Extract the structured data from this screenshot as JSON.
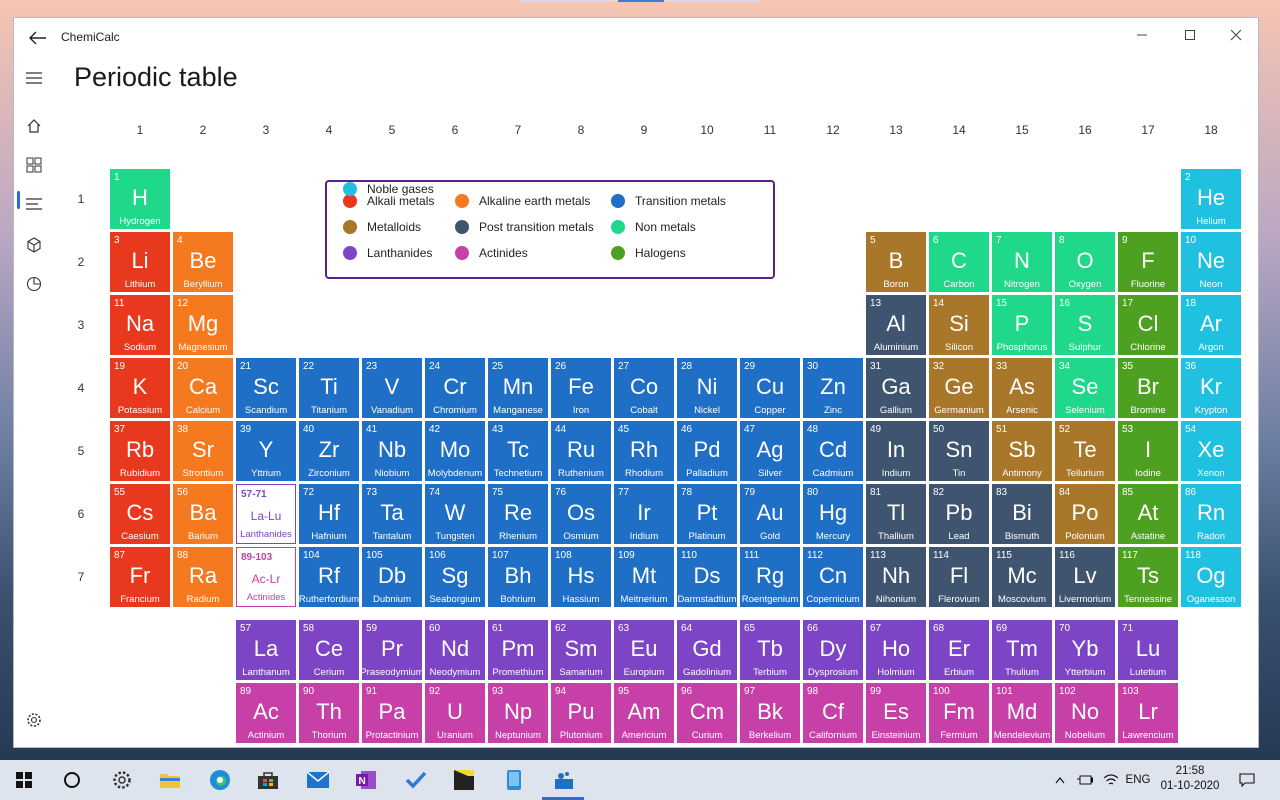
{
  "window": {
    "title": "ChemiCalc"
  },
  "page": {
    "title": "Periodic table"
  },
  "columns": [
    "1",
    "2",
    "3",
    "4",
    "5",
    "6",
    "7",
    "8",
    "9",
    "10",
    "11",
    "12",
    "13",
    "14",
    "15",
    "16",
    "17",
    "18"
  ],
  "periods": [
    "1",
    "2",
    "3",
    "4",
    "5",
    "6",
    "7"
  ],
  "colors": {
    "alkali": "#e8381e",
    "alkaline": "#f4791f",
    "transition": "#1f6fc6",
    "metalloid": "#a8772a",
    "post": "#3e546f",
    "nonmetal": "#20d88a",
    "lanthanide": "#7d45c6",
    "actinide": "#c640a8",
    "halogen": "#4ea120",
    "noble": "#1fc0e0"
  },
  "legend": [
    {
      "label": "Alkali metals",
      "cat": "alkali"
    },
    {
      "label": "Alkaline earth metals",
      "cat": "alkaline"
    },
    {
      "label": "Transition metals",
      "cat": "transition"
    },
    {
      "label": "Metalloids",
      "cat": "metalloid"
    },
    {
      "label": "Post transition metals",
      "cat": "post"
    },
    {
      "label": "Non metals",
      "cat": "nonmetal"
    },
    {
      "label": "Lanthanides",
      "cat": "lanthanide"
    },
    {
      "label": "Actinides",
      "cat": "actinide"
    },
    {
      "label": "Halogens",
      "cat": "halogen"
    },
    {
      "label": "Noble gases",
      "cat": "noble"
    }
  ],
  "placeholders": [
    {
      "range": "57-71",
      "symbol": "La-Lu",
      "name": "Lanthanides",
      "group": 3,
      "period": 6,
      "cat": "lanthanide"
    },
    {
      "range": "89-103",
      "symbol": "Ac-Lr",
      "name": "Actinides",
      "group": 3,
      "period": 7,
      "cat": "actinide"
    }
  ],
  "elements": [
    {
      "n": 1,
      "s": "H",
      "name": "Hydrogen",
      "g": 1,
      "p": 1,
      "c": "nonmetal"
    },
    {
      "n": 2,
      "s": "He",
      "name": "Helium",
      "g": 18,
      "p": 1,
      "c": "noble"
    },
    {
      "n": 3,
      "s": "Li",
      "name": "Lithium",
      "g": 1,
      "p": 2,
      "c": "alkali"
    },
    {
      "n": 4,
      "s": "Be",
      "name": "Beryllium",
      "g": 2,
      "p": 2,
      "c": "alkaline"
    },
    {
      "n": 5,
      "s": "B",
      "name": "Boron",
      "g": 13,
      "p": 2,
      "c": "metalloid"
    },
    {
      "n": 6,
      "s": "C",
      "name": "Carbon",
      "g": 14,
      "p": 2,
      "c": "nonmetal"
    },
    {
      "n": 7,
      "s": "N",
      "name": "Nitrogen",
      "g": 15,
      "p": 2,
      "c": "nonmetal"
    },
    {
      "n": 8,
      "s": "O",
      "name": "Oxygen",
      "g": 16,
      "p": 2,
      "c": "nonmetal"
    },
    {
      "n": 9,
      "s": "F",
      "name": "Fluorine",
      "g": 17,
      "p": 2,
      "c": "halogen"
    },
    {
      "n": 10,
      "s": "Ne",
      "name": "Neon",
      "g": 18,
      "p": 2,
      "c": "noble"
    },
    {
      "n": 11,
      "s": "Na",
      "name": "Sodium",
      "g": 1,
      "p": 3,
      "c": "alkali"
    },
    {
      "n": 12,
      "s": "Mg",
      "name": "Magnesium",
      "g": 2,
      "p": 3,
      "c": "alkaline"
    },
    {
      "n": 13,
      "s": "Al",
      "name": "Aluminium",
      "g": 13,
      "p": 3,
      "c": "post"
    },
    {
      "n": 14,
      "s": "Si",
      "name": "Silicon",
      "g": 14,
      "p": 3,
      "c": "metalloid"
    },
    {
      "n": 15,
      "s": "P",
      "name": "Phosphorus",
      "g": 15,
      "p": 3,
      "c": "nonmetal"
    },
    {
      "n": 16,
      "s": "S",
      "name": "Sulphur",
      "g": 16,
      "p": 3,
      "c": "nonmetal"
    },
    {
      "n": 17,
      "s": "Cl",
      "name": "Chlorine",
      "g": 17,
      "p": 3,
      "c": "halogen"
    },
    {
      "n": 18,
      "s": "Ar",
      "name": "Argon",
      "g": 18,
      "p": 3,
      "c": "noble"
    },
    {
      "n": 19,
      "s": "K",
      "name": "Potassium",
      "g": 1,
      "p": 4,
      "c": "alkali"
    },
    {
      "n": 20,
      "s": "Ca",
      "name": "Calcium",
      "g": 2,
      "p": 4,
      "c": "alkaline"
    },
    {
      "n": 21,
      "s": "Sc",
      "name": "Scandium",
      "g": 3,
      "p": 4,
      "c": "transition"
    },
    {
      "n": 22,
      "s": "Ti",
      "name": "Titanium",
      "g": 4,
      "p": 4,
      "c": "transition"
    },
    {
      "n": 23,
      "s": "V",
      "name": "Vanadium",
      "g": 5,
      "p": 4,
      "c": "transition"
    },
    {
      "n": 24,
      "s": "Cr",
      "name": "Chromium",
      "g": 6,
      "p": 4,
      "c": "transition"
    },
    {
      "n": 25,
      "s": "Mn",
      "name": "Manganese",
      "g": 7,
      "p": 4,
      "c": "transition"
    },
    {
      "n": 26,
      "s": "Fe",
      "name": "Iron",
      "g": 8,
      "p": 4,
      "c": "transition"
    },
    {
      "n": 27,
      "s": "Co",
      "name": "Cobalt",
      "g": 9,
      "p": 4,
      "c": "transition"
    },
    {
      "n": 28,
      "s": "Ni",
      "name": "Nickel",
      "g": 10,
      "p": 4,
      "c": "transition"
    },
    {
      "n": 29,
      "s": "Cu",
      "name": "Copper",
      "g": 11,
      "p": 4,
      "c": "transition"
    },
    {
      "n": 30,
      "s": "Zn",
      "name": "Zinc",
      "g": 12,
      "p": 4,
      "c": "transition"
    },
    {
      "n": 31,
      "s": "Ga",
      "name": "Gallium",
      "g": 13,
      "p": 4,
      "c": "post"
    },
    {
      "n": 32,
      "s": "Ge",
      "name": "Germanium",
      "g": 14,
      "p": 4,
      "c": "metalloid"
    },
    {
      "n": 33,
      "s": "As",
      "name": "Arsenic",
      "g": 15,
      "p": 4,
      "c": "metalloid"
    },
    {
      "n": 34,
      "s": "Se",
      "name": "Selenium",
      "g": 16,
      "p": 4,
      "c": "nonmetal"
    },
    {
      "n": 35,
      "s": "Br",
      "name": "Bromine",
      "g": 17,
      "p": 4,
      "c": "halogen"
    },
    {
      "n": 36,
      "s": "Kr",
      "name": "Krypton",
      "g": 18,
      "p": 4,
      "c": "noble"
    },
    {
      "n": 37,
      "s": "Rb",
      "name": "Rubidium",
      "g": 1,
      "p": 5,
      "c": "alkali"
    },
    {
      "n": 38,
      "s": "Sr",
      "name": "Strontium",
      "g": 2,
      "p": 5,
      "c": "alkaline"
    },
    {
      "n": 39,
      "s": "Y",
      "name": "Yttrium",
      "g": 3,
      "p": 5,
      "c": "transition"
    },
    {
      "n": 40,
      "s": "Zr",
      "name": "Zirconium",
      "g": 4,
      "p": 5,
      "c": "transition"
    },
    {
      "n": 41,
      "s": "Nb",
      "name": "Niobium",
      "g": 5,
      "p": 5,
      "c": "transition"
    },
    {
      "n": 42,
      "s": "Mo",
      "name": "Molybdenum",
      "g": 6,
      "p": 5,
      "c": "transition"
    },
    {
      "n": 43,
      "s": "Tc",
      "name": "Technetium",
      "g": 7,
      "p": 5,
      "c": "transition"
    },
    {
      "n": 44,
      "s": "Ru",
      "name": "Ruthenium",
      "g": 8,
      "p": 5,
      "c": "transition"
    },
    {
      "n": 45,
      "s": "Rh",
      "name": "Rhodium",
      "g": 9,
      "p": 5,
      "c": "transition"
    },
    {
      "n": 46,
      "s": "Pd",
      "name": "Palladium",
      "g": 10,
      "p": 5,
      "c": "transition"
    },
    {
      "n": 47,
      "s": "Ag",
      "name": "Silver",
      "g": 11,
      "p": 5,
      "c": "transition"
    },
    {
      "n": 48,
      "s": "Cd",
      "name": "Cadmium",
      "g": 12,
      "p": 5,
      "c": "transition"
    },
    {
      "n": 49,
      "s": "In",
      "name": "Indium",
      "g": 13,
      "p": 5,
      "c": "post"
    },
    {
      "n": 50,
      "s": "Sn",
      "name": "Tin",
      "g": 14,
      "p": 5,
      "c": "post"
    },
    {
      "n": 51,
      "s": "Sb",
      "name": "Antimony",
      "g": 15,
      "p": 5,
      "c": "metalloid"
    },
    {
      "n": 52,
      "s": "Te",
      "name": "Tellurium",
      "g": 16,
      "p": 5,
      "c": "metalloid"
    },
    {
      "n": 53,
      "s": "I",
      "name": "Iodine",
      "g": 17,
      "p": 5,
      "c": "halogen"
    },
    {
      "n": 54,
      "s": "Xe",
      "name": "Xenon",
      "g": 18,
      "p": 5,
      "c": "noble"
    },
    {
      "n": 55,
      "s": "Cs",
      "name": "Caesium",
      "g": 1,
      "p": 6,
      "c": "alkali"
    },
    {
      "n": 56,
      "s": "Ba",
      "name": "Barium",
      "g": 2,
      "p": 6,
      "c": "alkaline"
    },
    {
      "n": 72,
      "s": "Hf",
      "name": "Hafnium",
      "g": 4,
      "p": 6,
      "c": "transition"
    },
    {
      "n": 73,
      "s": "Ta",
      "name": "Tantalum",
      "g": 5,
      "p": 6,
      "c": "transition"
    },
    {
      "n": 74,
      "s": "W",
      "name": "Tungsten",
      "g": 6,
      "p": 6,
      "c": "transition"
    },
    {
      "n": 75,
      "s": "Re",
      "name": "Rhenium",
      "g": 7,
      "p": 6,
      "c": "transition"
    },
    {
      "n": 76,
      "s": "Os",
      "name": "Osmium",
      "g": 8,
      "p": 6,
      "c": "transition"
    },
    {
      "n": 77,
      "s": "Ir",
      "name": "Iridium",
      "g": 9,
      "p": 6,
      "c": "transition"
    },
    {
      "n": 78,
      "s": "Pt",
      "name": "Platinum",
      "g": 10,
      "p": 6,
      "c": "transition"
    },
    {
      "n": 79,
      "s": "Au",
      "name": "Gold",
      "g": 11,
      "p": 6,
      "c": "transition"
    },
    {
      "n": 80,
      "s": "Hg",
      "name": "Mercury",
      "g": 12,
      "p": 6,
      "c": "transition"
    },
    {
      "n": 81,
      "s": "Tl",
      "name": "Thallium",
      "g": 13,
      "p": 6,
      "c": "post"
    },
    {
      "n": 82,
      "s": "Pb",
      "name": "Lead",
      "g": 14,
      "p": 6,
      "c": "post"
    },
    {
      "n": 83,
      "s": "Bi",
      "name": "Bismuth",
      "g": 15,
      "p": 6,
      "c": "post"
    },
    {
      "n": 84,
      "s": "Po",
      "name": "Polonium",
      "g": 16,
      "p": 6,
      "c": "metalloid"
    },
    {
      "n": 85,
      "s": "At",
      "name": "Astatine",
      "g": 17,
      "p": 6,
      "c": "halogen"
    },
    {
      "n": 86,
      "s": "Rn",
      "name": "Radon",
      "g": 18,
      "p": 6,
      "c": "noble"
    },
    {
      "n": 87,
      "s": "Fr",
      "name": "Francium",
      "g": 1,
      "p": 7,
      "c": "alkali"
    },
    {
      "n": 88,
      "s": "Ra",
      "name": "Radium",
      "g": 2,
      "p": 7,
      "c": "alkaline"
    },
    {
      "n": 104,
      "s": "Rf",
      "name": "Rutherfordium",
      "g": 4,
      "p": 7,
      "c": "transition"
    },
    {
      "n": 105,
      "s": "Db",
      "name": "Dubnium",
      "g": 5,
      "p": 7,
      "c": "transition"
    },
    {
      "n": 106,
      "s": "Sg",
      "name": "Seaborgium",
      "g": 6,
      "p": 7,
      "c": "transition"
    },
    {
      "n": 107,
      "s": "Bh",
      "name": "Bohrium",
      "g": 7,
      "p": 7,
      "c": "transition"
    },
    {
      "n": 108,
      "s": "Hs",
      "name": "Hassium",
      "g": 8,
      "p": 7,
      "c": "transition"
    },
    {
      "n": 109,
      "s": "Mt",
      "name": "Meitnerium",
      "g": 9,
      "p": 7,
      "c": "transition"
    },
    {
      "n": 110,
      "s": "Ds",
      "name": "Darmstadtium",
      "g": 10,
      "p": 7,
      "c": "transition"
    },
    {
      "n": 111,
      "s": "Rg",
      "name": "Roentgenium",
      "g": 11,
      "p": 7,
      "c": "transition"
    },
    {
      "n": 112,
      "s": "Cn",
      "name": "Copernicium",
      "g": 12,
      "p": 7,
      "c": "transition"
    },
    {
      "n": 113,
      "s": "Nh",
      "name": "Nihonium",
      "g": 13,
      "p": 7,
      "c": "post"
    },
    {
      "n": 114,
      "s": "Fl",
      "name": "Flerovium",
      "g": 14,
      "p": 7,
      "c": "post"
    },
    {
      "n": 115,
      "s": "Mc",
      "name": "Moscovium",
      "g": 15,
      "p": 7,
      "c": "post"
    },
    {
      "n": 116,
      "s": "Lv",
      "name": "Livermorium",
      "g": 16,
      "p": 7,
      "c": "post"
    },
    {
      "n": 117,
      "s": "Ts",
      "name": "Tennessine",
      "g": 17,
      "p": 7,
      "c": "halogen"
    },
    {
      "n": 118,
      "s": "Og",
      "name": "Oganesson",
      "g": 18,
      "p": 7,
      "c": "noble"
    }
  ],
  "lanthanides": [
    {
      "n": 57,
      "s": "La",
      "name": "Lanthanum"
    },
    {
      "n": 58,
      "s": "Ce",
      "name": "Cerium"
    },
    {
      "n": 59,
      "s": "Pr",
      "name": "Praseodymium"
    },
    {
      "n": 60,
      "s": "Nd",
      "name": "Neodymium"
    },
    {
      "n": 61,
      "s": "Pm",
      "name": "Promethium"
    },
    {
      "n": 62,
      "s": "Sm",
      "name": "Samarium"
    },
    {
      "n": 63,
      "s": "Eu",
      "name": "Europium"
    },
    {
      "n": 64,
      "s": "Gd",
      "name": "Gadolinium"
    },
    {
      "n": 65,
      "s": "Tb",
      "name": "Terbium"
    },
    {
      "n": 66,
      "s": "Dy",
      "name": "Dysprosium"
    },
    {
      "n": 67,
      "s": "Ho",
      "name": "Holmium"
    },
    {
      "n": 68,
      "s": "Er",
      "name": "Erbium"
    },
    {
      "n": 69,
      "s": "Tm",
      "name": "Thulium"
    },
    {
      "n": 70,
      "s": "Yb",
      "name": "Ytterbium"
    },
    {
      "n": 71,
      "s": "Lu",
      "name": "Lutetium"
    }
  ],
  "actinides": [
    {
      "n": 89,
      "s": "Ac",
      "name": "Actinium"
    },
    {
      "n": 90,
      "s": "Th",
      "name": "Thorium"
    },
    {
      "n": 91,
      "s": "Pa",
      "name": "Protactinium"
    },
    {
      "n": 92,
      "s": "U",
      "name": "Uranium"
    },
    {
      "n": 93,
      "s": "Np",
      "name": "Neptunium"
    },
    {
      "n": 94,
      "s": "Pu",
      "name": "Plutonium"
    },
    {
      "n": 95,
      "s": "Am",
      "name": "Americium"
    },
    {
      "n": 96,
      "s": "Cm",
      "name": "Curium"
    },
    {
      "n": 97,
      "s": "Bk",
      "name": "Berkelium"
    },
    {
      "n": 98,
      "s": "Cf",
      "name": "Californium"
    },
    {
      "n": 99,
      "s": "Es",
      "name": "Einsteinium"
    },
    {
      "n": 100,
      "s": "Fm",
      "name": "Fermium"
    },
    {
      "n": 101,
      "s": "Md",
      "name": "Mendelevium"
    },
    {
      "n": 102,
      "s": "No",
      "name": "Nobelium"
    },
    {
      "n": 103,
      "s": "Lr",
      "name": "Lawrencium"
    }
  ],
  "taskbar": {
    "apps": [
      "windows-start-icon",
      "cortana-icon",
      "settings-icon",
      "file-explorer-icon",
      "edge-icon",
      "store-icon",
      "mail-icon",
      "onenote-icon",
      "todo-icon",
      "sticky-notes-icon",
      "phone-icon",
      "chemicalc-icon"
    ],
    "language": "ENG",
    "time": "21:58",
    "date": "01-10-2020"
  }
}
